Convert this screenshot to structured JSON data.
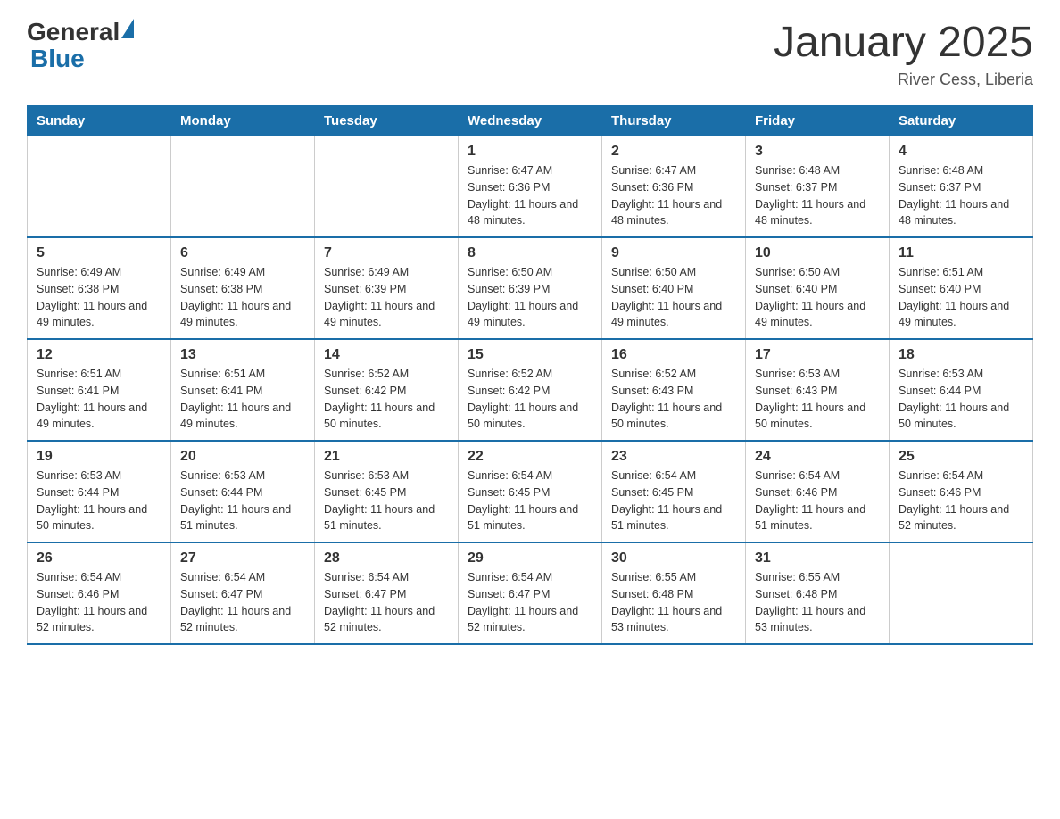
{
  "header": {
    "logo_general": "General",
    "logo_blue": "Blue",
    "title": "January 2025",
    "subtitle": "River Cess, Liberia"
  },
  "calendar": {
    "days_of_week": [
      "Sunday",
      "Monday",
      "Tuesday",
      "Wednesday",
      "Thursday",
      "Friday",
      "Saturday"
    ],
    "weeks": [
      [
        {
          "day": "",
          "info": ""
        },
        {
          "day": "",
          "info": ""
        },
        {
          "day": "",
          "info": ""
        },
        {
          "day": "1",
          "info": "Sunrise: 6:47 AM\nSunset: 6:36 PM\nDaylight: 11 hours and 48 minutes."
        },
        {
          "day": "2",
          "info": "Sunrise: 6:47 AM\nSunset: 6:36 PM\nDaylight: 11 hours and 48 minutes."
        },
        {
          "day": "3",
          "info": "Sunrise: 6:48 AM\nSunset: 6:37 PM\nDaylight: 11 hours and 48 minutes."
        },
        {
          "day": "4",
          "info": "Sunrise: 6:48 AM\nSunset: 6:37 PM\nDaylight: 11 hours and 48 minutes."
        }
      ],
      [
        {
          "day": "5",
          "info": "Sunrise: 6:49 AM\nSunset: 6:38 PM\nDaylight: 11 hours and 49 minutes."
        },
        {
          "day": "6",
          "info": "Sunrise: 6:49 AM\nSunset: 6:38 PM\nDaylight: 11 hours and 49 minutes."
        },
        {
          "day": "7",
          "info": "Sunrise: 6:49 AM\nSunset: 6:39 PM\nDaylight: 11 hours and 49 minutes."
        },
        {
          "day": "8",
          "info": "Sunrise: 6:50 AM\nSunset: 6:39 PM\nDaylight: 11 hours and 49 minutes."
        },
        {
          "day": "9",
          "info": "Sunrise: 6:50 AM\nSunset: 6:40 PM\nDaylight: 11 hours and 49 minutes."
        },
        {
          "day": "10",
          "info": "Sunrise: 6:50 AM\nSunset: 6:40 PM\nDaylight: 11 hours and 49 minutes."
        },
        {
          "day": "11",
          "info": "Sunrise: 6:51 AM\nSunset: 6:40 PM\nDaylight: 11 hours and 49 minutes."
        }
      ],
      [
        {
          "day": "12",
          "info": "Sunrise: 6:51 AM\nSunset: 6:41 PM\nDaylight: 11 hours and 49 minutes."
        },
        {
          "day": "13",
          "info": "Sunrise: 6:51 AM\nSunset: 6:41 PM\nDaylight: 11 hours and 49 minutes."
        },
        {
          "day": "14",
          "info": "Sunrise: 6:52 AM\nSunset: 6:42 PM\nDaylight: 11 hours and 50 minutes."
        },
        {
          "day": "15",
          "info": "Sunrise: 6:52 AM\nSunset: 6:42 PM\nDaylight: 11 hours and 50 minutes."
        },
        {
          "day": "16",
          "info": "Sunrise: 6:52 AM\nSunset: 6:43 PM\nDaylight: 11 hours and 50 minutes."
        },
        {
          "day": "17",
          "info": "Sunrise: 6:53 AM\nSunset: 6:43 PM\nDaylight: 11 hours and 50 minutes."
        },
        {
          "day": "18",
          "info": "Sunrise: 6:53 AM\nSunset: 6:44 PM\nDaylight: 11 hours and 50 minutes."
        }
      ],
      [
        {
          "day": "19",
          "info": "Sunrise: 6:53 AM\nSunset: 6:44 PM\nDaylight: 11 hours and 50 minutes."
        },
        {
          "day": "20",
          "info": "Sunrise: 6:53 AM\nSunset: 6:44 PM\nDaylight: 11 hours and 51 minutes."
        },
        {
          "day": "21",
          "info": "Sunrise: 6:53 AM\nSunset: 6:45 PM\nDaylight: 11 hours and 51 minutes."
        },
        {
          "day": "22",
          "info": "Sunrise: 6:54 AM\nSunset: 6:45 PM\nDaylight: 11 hours and 51 minutes."
        },
        {
          "day": "23",
          "info": "Sunrise: 6:54 AM\nSunset: 6:45 PM\nDaylight: 11 hours and 51 minutes."
        },
        {
          "day": "24",
          "info": "Sunrise: 6:54 AM\nSunset: 6:46 PM\nDaylight: 11 hours and 51 minutes."
        },
        {
          "day": "25",
          "info": "Sunrise: 6:54 AM\nSunset: 6:46 PM\nDaylight: 11 hours and 52 minutes."
        }
      ],
      [
        {
          "day": "26",
          "info": "Sunrise: 6:54 AM\nSunset: 6:46 PM\nDaylight: 11 hours and 52 minutes."
        },
        {
          "day": "27",
          "info": "Sunrise: 6:54 AM\nSunset: 6:47 PM\nDaylight: 11 hours and 52 minutes."
        },
        {
          "day": "28",
          "info": "Sunrise: 6:54 AM\nSunset: 6:47 PM\nDaylight: 11 hours and 52 minutes."
        },
        {
          "day": "29",
          "info": "Sunrise: 6:54 AM\nSunset: 6:47 PM\nDaylight: 11 hours and 52 minutes."
        },
        {
          "day": "30",
          "info": "Sunrise: 6:55 AM\nSunset: 6:48 PM\nDaylight: 11 hours and 53 minutes."
        },
        {
          "day": "31",
          "info": "Sunrise: 6:55 AM\nSunset: 6:48 PM\nDaylight: 11 hours and 53 minutes."
        },
        {
          "day": "",
          "info": ""
        }
      ]
    ]
  }
}
